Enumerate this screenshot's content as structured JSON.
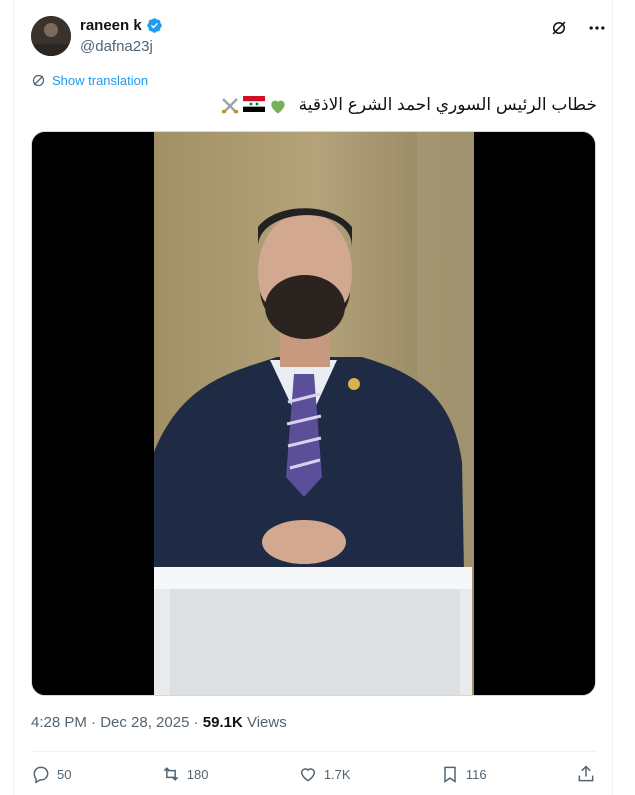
{
  "author": {
    "name": "raneen k",
    "handle": "@dafna23j",
    "verified": true
  },
  "top_actions": {
    "grok_icon": "grok-icon",
    "more_icon": "more-icon"
  },
  "translate": {
    "label": "Show translation"
  },
  "tweet": {
    "text": "خطاب  الرئيس السوري احمد الشرع الاذقية"
  },
  "media": {
    "type": "video"
  },
  "meta": {
    "time": "4:28 PM · Dec 28, 2025 · ",
    "views_count": "59.1K",
    "views_label": " Views"
  },
  "engagement": {
    "replies": "50",
    "reposts": "180",
    "likes": "1.7K",
    "bookmarks": "116"
  },
  "colors": {
    "accent": "#1d9bf0",
    "muted": "#536471",
    "text": "#0f1419"
  }
}
